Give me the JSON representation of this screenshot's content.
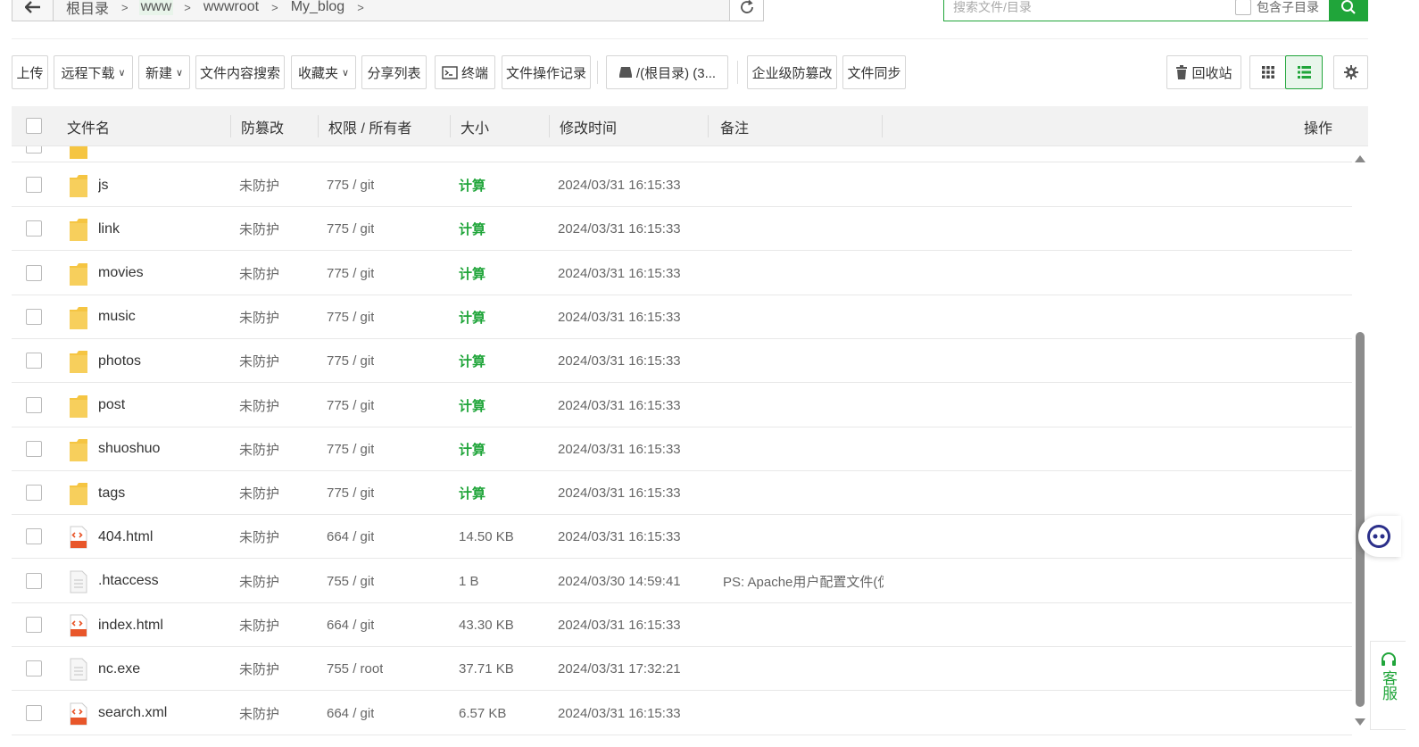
{
  "breadcrumb": {
    "items": [
      "根目录",
      "www",
      "wwwroot",
      "My_blog"
    ]
  },
  "search": {
    "placeholder": "搜索文件/目录",
    "include_subdir_label": "包含子目录"
  },
  "toolbar": {
    "upload": "上传",
    "remote_download": "远程下载",
    "new": "新建",
    "content_search": "文件内容搜索",
    "favorites": "收藏夹",
    "share_list": "分享列表",
    "terminal": "终端",
    "operation_log": "文件操作记录",
    "disk": "/(根目录) (3...",
    "tamper_proof": "企业级防篡改",
    "file_sync": "文件同步",
    "recycle_bin": "回收站"
  },
  "table": {
    "columns": {
      "name": "文件名",
      "protect": "防篡改",
      "perm": "权限 / 所有者",
      "size": "大小",
      "mtime": "修改时间",
      "remark": "备注",
      "action": "操作"
    },
    "rows": [
      {
        "name": "js",
        "type": "folder",
        "protect": "未防护",
        "perm": "775 / git",
        "size": "计算",
        "mtime": "2024/03/31 16:15:33",
        "remark": ""
      },
      {
        "name": "link",
        "type": "folder",
        "protect": "未防护",
        "perm": "775 / git",
        "size": "计算",
        "mtime": "2024/03/31 16:15:33",
        "remark": ""
      },
      {
        "name": "movies",
        "type": "folder",
        "protect": "未防护",
        "perm": "775 / git",
        "size": "计算",
        "mtime": "2024/03/31 16:15:33",
        "remark": ""
      },
      {
        "name": "music",
        "type": "folder",
        "protect": "未防护",
        "perm": "775 / git",
        "size": "计算",
        "mtime": "2024/03/31 16:15:33",
        "remark": ""
      },
      {
        "name": "photos",
        "type": "folder",
        "protect": "未防护",
        "perm": "775 / git",
        "size": "计算",
        "mtime": "2024/03/31 16:15:33",
        "remark": ""
      },
      {
        "name": "post",
        "type": "folder",
        "protect": "未防护",
        "perm": "775 / git",
        "size": "计算",
        "mtime": "2024/03/31 16:15:33",
        "remark": ""
      },
      {
        "name": "shuoshuo",
        "type": "folder",
        "protect": "未防护",
        "perm": "775 / git",
        "size": "计算",
        "mtime": "2024/03/31 16:15:33",
        "remark": ""
      },
      {
        "name": "tags",
        "type": "folder",
        "protect": "未防护",
        "perm": "775 / git",
        "size": "计算",
        "mtime": "2024/03/31 16:15:33",
        "remark": ""
      },
      {
        "name": "404.html",
        "type": "html",
        "protect": "未防护",
        "perm": "664 / git",
        "size": "14.50 KB",
        "mtime": "2024/03/31 16:15:33",
        "remark": ""
      },
      {
        "name": ".htaccess",
        "type": "file",
        "protect": "未防护",
        "perm": "755 / git",
        "size": "1 B",
        "mtime": "2024/03/30 14:59:41",
        "remark": "PS: Apache用户配置文件(伪"
      },
      {
        "name": "index.html",
        "type": "html",
        "protect": "未防护",
        "perm": "664 / git",
        "size": "43.30 KB",
        "mtime": "2024/03/31 16:15:33",
        "remark": ""
      },
      {
        "name": "nc.exe",
        "type": "file",
        "protect": "未防护",
        "perm": "755 / root",
        "size": "37.71 KB",
        "mtime": "2024/03/31 17:32:21",
        "remark": ""
      },
      {
        "name": "search.xml",
        "type": "xml",
        "protect": "未防护",
        "perm": "664 / git",
        "size": "6.57 KB",
        "mtime": "2024/03/31 16:15:33",
        "remark": ""
      }
    ]
  },
  "service": {
    "label": "客服"
  },
  "colors": {
    "accent": "#20a53a",
    "folder": "#f5c542",
    "html_icon": "#e8562a"
  }
}
